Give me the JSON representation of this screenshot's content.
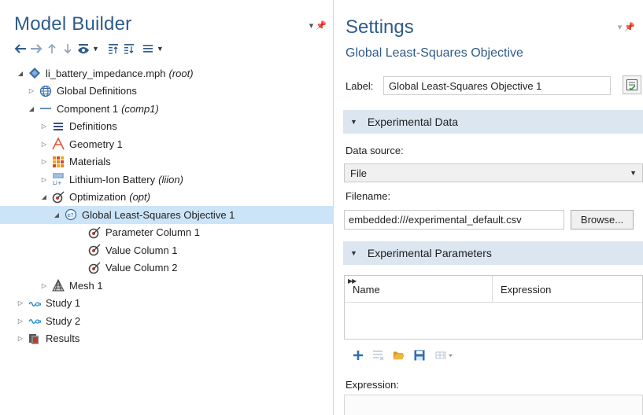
{
  "left_panel": {
    "title": "Model Builder",
    "tree": [
      {
        "label": "li_battery_impedance.mph",
        "tag": "(root)"
      },
      {
        "label": "Global Definitions",
        "tag": ""
      },
      {
        "label": "Component 1",
        "tag": "(comp1)"
      },
      {
        "label": "Definitions",
        "tag": ""
      },
      {
        "label": "Geometry 1",
        "tag": ""
      },
      {
        "label": "Materials",
        "tag": ""
      },
      {
        "label": "Lithium-Ion Battery",
        "tag": "(liion)"
      },
      {
        "label": "Optimization",
        "tag": "(opt)"
      },
      {
        "label": "Global Least-Squares Objective 1",
        "tag": ""
      },
      {
        "label": "Parameter Column 1",
        "tag": ""
      },
      {
        "label": "Value Column 1",
        "tag": ""
      },
      {
        "label": "Value Column 2",
        "tag": ""
      },
      {
        "label": "Mesh 1",
        "tag": ""
      },
      {
        "label": "Study 1",
        "tag": ""
      },
      {
        "label": "Study 2",
        "tag": ""
      },
      {
        "label": "Results",
        "tag": ""
      }
    ]
  },
  "right_panel": {
    "title": "Settings",
    "subtitle": "Global Least-Squares Objective",
    "label_caption": "Label:",
    "label_value": "Global Least-Squares Objective 1",
    "section_experimental_data": "Experimental Data",
    "data_source_caption": "Data source:",
    "data_source_value": "File",
    "filename_caption": "Filename:",
    "filename_value": "embedded:///experimental_default.csv",
    "browse_label": "Browse...",
    "section_experimental_parameters": "Experimental Parameters",
    "table_headers": [
      "Name",
      "Expression"
    ],
    "expression_caption": "Expression:"
  },
  "colors": {
    "title_blue": "#2e5b8a",
    "section_bg": "#dbe6f1",
    "selected_row": "#cce4f7"
  },
  "icons": [
    "back-arrow-icon",
    "forward-arrow-icon",
    "up-arrow-icon",
    "down-arrow-icon",
    "show-icon",
    "collapse-icon",
    "expand-icon",
    "list-icon",
    "add-icon",
    "delete-list-icon",
    "open-folder-icon",
    "save-icon",
    "table-settings-icon"
  ]
}
